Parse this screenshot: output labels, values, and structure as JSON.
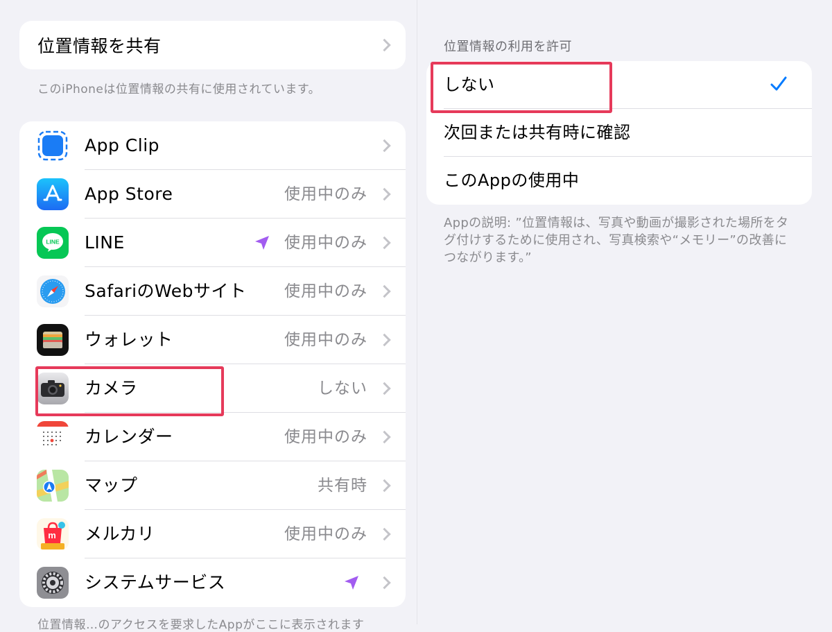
{
  "left": {
    "share_location": {
      "label": "位置情報を共有"
    },
    "share_footnote": "このiPhoneは位置情報の共有に使用されています。",
    "apps": [
      {
        "name": "App Clip",
        "status": "",
        "icon": "app-clip-icon",
        "arrow": false
      },
      {
        "name": "App Store",
        "status": "使用中のみ",
        "icon": "app-store-icon",
        "arrow": false
      },
      {
        "name": "LINE",
        "status": "使用中のみ",
        "icon": "line-icon",
        "arrow": true
      },
      {
        "name": "SafariのWebサイト",
        "status": "使用中のみ",
        "icon": "safari-icon",
        "arrow": false
      },
      {
        "name": "ウォレット",
        "status": "使用中のみ",
        "icon": "wallet-icon",
        "arrow": false
      },
      {
        "name": "カメラ",
        "status": "しない",
        "icon": "camera-icon",
        "arrow": false
      },
      {
        "name": "カレンダー",
        "status": "使用中のみ",
        "icon": "calendar-icon",
        "arrow": false
      },
      {
        "name": "マップ",
        "status": "共有時",
        "icon": "maps-icon",
        "arrow": false
      },
      {
        "name": "メルカリ",
        "status": "使用中のみ",
        "icon": "mercari-icon",
        "arrow": false
      },
      {
        "name": "システムサービス",
        "status": "",
        "icon": "settings-gear-icon",
        "arrow": true
      }
    ],
    "cut_footer": "位置情報…のアクセスを要求したAppがここに表示されます"
  },
  "right": {
    "section_header": "位置情報の利用を許可",
    "options": [
      {
        "label": "しない",
        "selected": true
      },
      {
        "label": "次回または共有時に確認",
        "selected": false
      },
      {
        "label": "このAppの使用中",
        "selected": false
      }
    ],
    "description": "Appの説明: ”位置情報は、写真や動画が撮影された場所をタグ付けするために使用され、写真検索や“メモリー”の改善につながります。”"
  },
  "colors": {
    "accent": "#007aff",
    "highlight": "#e63a5a",
    "location_arrow": "#a25cf0",
    "secondary_text": "#8a8a8e"
  }
}
